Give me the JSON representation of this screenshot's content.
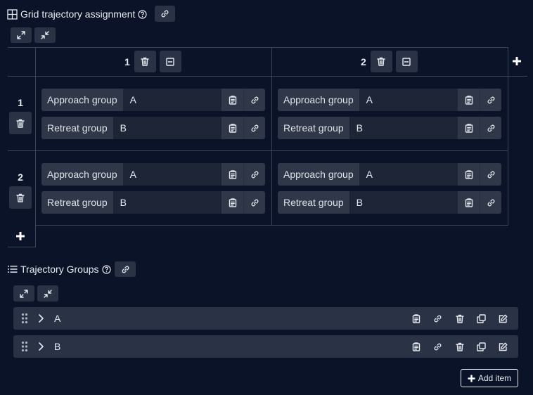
{
  "grid": {
    "title": "Grid trajectory assignment",
    "columns": [
      {
        "label": "1"
      },
      {
        "label": "2"
      }
    ],
    "rows": [
      {
        "label": "1",
        "cells": [
          {
            "approach_label": "Approach group",
            "approach_value": "A",
            "retreat_label": "Retreat group",
            "retreat_value": "B"
          },
          {
            "approach_label": "Approach group",
            "approach_value": "A",
            "retreat_label": "Retreat group",
            "retreat_value": "B"
          }
        ]
      },
      {
        "label": "2",
        "cells": [
          {
            "approach_label": "Approach group",
            "approach_value": "A",
            "retreat_label": "Retreat group",
            "retreat_value": "B"
          },
          {
            "approach_label": "Approach group",
            "approach_value": "A",
            "retreat_label": "Retreat group",
            "retreat_value": "B"
          }
        ]
      }
    ]
  },
  "groups": {
    "title": "Trajectory Groups",
    "items": [
      {
        "label": "A"
      },
      {
        "label": "B"
      }
    ],
    "add_label": "Add item"
  },
  "icons": {
    "grid_icon": "grid-icon",
    "help": "help-circle-icon",
    "link": "link-icon",
    "expand": "expand-icon",
    "collapse": "collapse-icon",
    "trash": "trash-icon",
    "minus_box": "minus-square-icon",
    "plus": "plus-icon",
    "clipboard": "clipboard-icon",
    "list": "list-icon",
    "drag": "drag-handle-icon",
    "chevron": "chevron-right-icon",
    "copy": "copy-icon",
    "edit": "edit-icon"
  },
  "colors": {
    "background": "#0a1328",
    "button": "#2a3346",
    "field_value": "#1e2536",
    "grid_line": "#3b4354"
  }
}
